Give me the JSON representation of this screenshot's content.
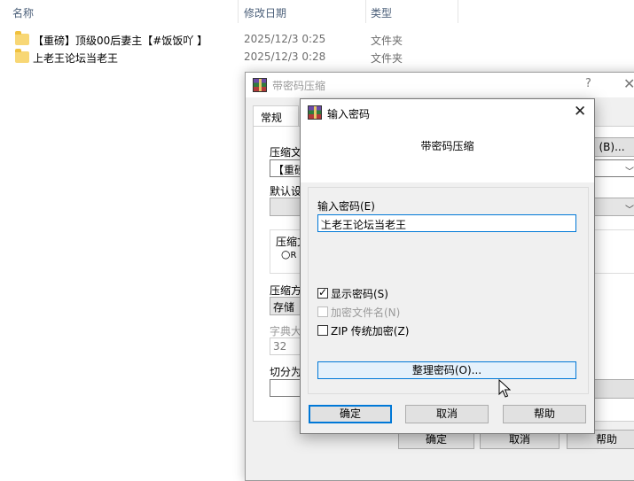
{
  "explorer": {
    "columns": {
      "name": "名称",
      "date": "修改日期",
      "type": "类型"
    },
    "rows": [
      {
        "name": "【重磅】顶级00后妻主【#饭饭吖 】",
        "date": "2025/12/3 0:25",
        "type": "文件夹"
      },
      {
        "name": "上老王论坛当老王",
        "date": "2025/12/3 0:28",
        "type": "文件夹"
      }
    ]
  },
  "bg_dialog": {
    "title": "带密码压缩",
    "help_glyph": "?",
    "close_glyph": "✕",
    "tab_general": "常规",
    "browse_label": "(B)...",
    "archive_name_label": "压缩文",
    "archive_name_value": "【重磅",
    "default_profile_label": "默认设",
    "format_group_label": "压缩文",
    "radio_partial": "R",
    "method_label": "压缩方",
    "method_value": "存储",
    "dict_label": "字典大",
    "dict_value": "32",
    "split_label": "切分为",
    "ok_label": "确定",
    "cancel_label": "取消",
    "help_label": "帮助"
  },
  "dialog": {
    "title": "输入密码",
    "close_glyph": "✕",
    "profile_name": "带密码压缩",
    "password_label": "输入密码(E)",
    "password_value": "上老王论坛当老王",
    "show_password": {
      "label": "显示密码(S)",
      "checked": true
    },
    "encrypt_names": {
      "label": "加密文件名(N)",
      "checked": false,
      "disabled": true
    },
    "zip_legacy": {
      "label": "ZIP 传统加密(Z)",
      "checked": false
    },
    "organize_label": "整理密码(O)...",
    "ok_label": "确定",
    "cancel_label": "取消",
    "help_label": "帮助"
  },
  "icons": {
    "folder": "folder-icon",
    "app": "winrar-icon",
    "dropdown": "chevron-down-icon",
    "check": "checkmark-icon",
    "cursor": "mouse-pointer-icon"
  }
}
